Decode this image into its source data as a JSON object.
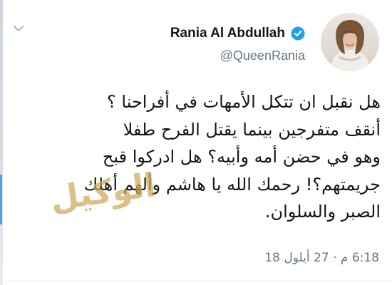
{
  "tweet": {
    "author": {
      "display_name": "Rania Al Abdullah",
      "handle": "@QueenRania",
      "verified": true
    },
    "text_lines": [
      "هل نقبل ان تتكل الأمهات في أفراحنا ؟",
      "أنقف متفرجين بينما يقتل الفرح طفلا",
      "وهو في حضن أمه وأبيه؟ هل ادركوا قبح",
      "جريمتهم؟! رحمك الله يا هاشم وألهم أهلك",
      "الصبر والسلوان."
    ],
    "timestamp": "6:18 م · 27 أيلول 18"
  },
  "watermark": {
    "text": "الوكيل"
  },
  "icons": {
    "menu": "chevron-down-icon",
    "verified": "verified-badge-icon",
    "avatar": "avatar"
  },
  "colors": {
    "text_primary": "#14171a",
    "text_secondary": "#657786",
    "verified_blue": "#1da1f2",
    "watermark_gold": "#cea858",
    "left_accent": "#5aa0d8"
  }
}
